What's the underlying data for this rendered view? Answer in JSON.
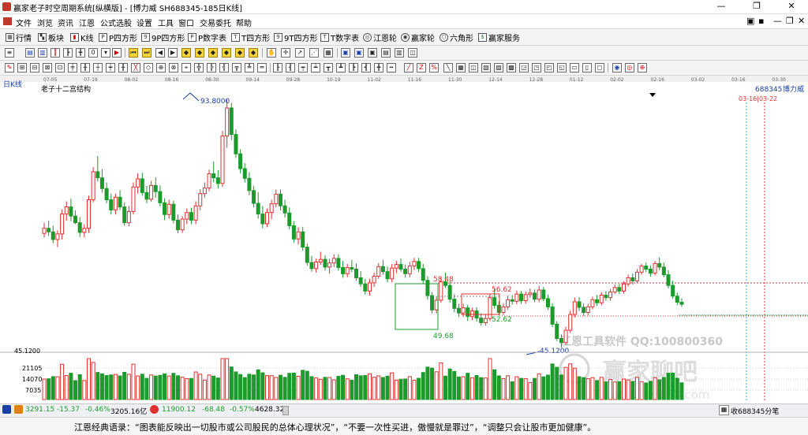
{
  "window": {
    "title": "赢家老子时空周期系统[纵横版] - [博力威  SH688345-185日K线]",
    "minimize": "—",
    "maximize": "❐",
    "close": "✕"
  },
  "menu": {
    "items": [
      "文件",
      "浏览",
      "资讯",
      "江恩",
      "公式选股",
      "设置",
      "工具",
      "窗口",
      "交易委托",
      "帮助"
    ],
    "right_icons": [
      "▣",
      "▪",
      "—",
      "❐",
      "✕"
    ]
  },
  "toolbar1": {
    "items": [
      {
        "label": "行情",
        "icon": "grid"
      },
      {
        "label": "板块",
        "icon": "blocks"
      },
      {
        "label": "K线",
        "icon": "candles"
      },
      {
        "label": "P四方形",
        "icon": "P"
      },
      {
        "label": "9P四方形",
        "icon": "9P"
      },
      {
        "label": "P数字表",
        "icon": "P"
      },
      {
        "label": "T四方形",
        "icon": "T"
      },
      {
        "label": "9T四方形",
        "icon": "9T"
      },
      {
        "label": "T数字表",
        "icon": "TN"
      },
      {
        "label": "江恩轮",
        "icon": "wheel"
      },
      {
        "label": "赢家轮",
        "icon": "wheel"
      },
      {
        "label": "六角形",
        "icon": "hex"
      },
      {
        "label": "赢家服务",
        "icon": "dollar"
      }
    ]
  },
  "chart": {
    "period_label": "日K线",
    "indicator_title": "老子十二宫结构",
    "x_dates": [
      "07-05",
      "07-19",
      "08-02",
      "08-16",
      "08-30",
      "09-14",
      "09-28",
      "10-19",
      "11-02",
      "11-16",
      "11-30",
      "12-14",
      "12-28",
      "01-12",
      "02-02",
      "02-16",
      "03-02",
      "03-16",
      "03-30"
    ],
    "stock_code": "688345",
    "stock_name": "博力威",
    "future_marker": "03-16|03-22",
    "price_labels": {
      "high": "93.8000",
      "low": "45.1200",
      "box1_top": "58.48",
      "box1_bottom": "49.68",
      "box2_top": "56.62",
      "box2_bottom": "52.62"
    },
    "volume_axis": [
      "45.1200",
      "21105",
      "14070",
      "7035"
    ],
    "watermark": {
      "software": "江恩工具软件  QQ:100800360",
      "brand": "赢家聊吧",
      "url": "liaoba.yy138.com"
    },
    "colors": {
      "up": "#e03030",
      "down": "#1c9b2c",
      "axis": "#a0a0a0",
      "guide_red": "#e03030",
      "box_green": "#1c9b2c",
      "label_blue": "#1a3ea8"
    }
  },
  "chart_data": {
    "type": "candlestick",
    "title": "老子十二宫结构",
    "symbol": "SH688345",
    "name": "博力威",
    "period": "日K线",
    "x_ticks": [
      "07-05",
      "07-19",
      "08-02",
      "08-16",
      "08-30",
      "09-14",
      "09-28",
      "10-19",
      "11-02",
      "11-16",
      "11-30",
      "12-14",
      "12-28",
      "01-12",
      "02-02",
      "02-16",
      "03-02",
      "03-16",
      "03-30"
    ],
    "price_range": [
      40,
      100
    ],
    "annotations": {
      "high": 93.8,
      "low": 45.12,
      "levels": [
        58.48,
        49.68,
        56.62,
        52.62
      ]
    },
    "volume_ticks": [
      21105,
      14070,
      7035
    ],
    "candles": [
      [
        67.5,
        69.6,
        66.7,
        68.5
      ],
      [
        68.5,
        70,
        67,
        67.8
      ],
      [
        67.8,
        69,
        65.6,
        66.3
      ],
      [
        66.3,
        68.1,
        64.8,
        67.4
      ],
      [
        67.4,
        72.2,
        66.3,
        71.3
      ],
      [
        71.3,
        73.8,
        70,
        72.7
      ],
      [
        72.7,
        74.3,
        69.9,
        70.9
      ],
      [
        70.9,
        72,
        69.3,
        69.6
      ],
      [
        69.6,
        70.7,
        66.8,
        67.7
      ],
      [
        67.7,
        69.3,
        66.7,
        68.5
      ],
      [
        68.5,
        74.9,
        67.6,
        74.1
      ],
      [
        74.1,
        80.5,
        73.6,
        79.6
      ],
      [
        79.6,
        82.7,
        77.7,
        78.4
      ],
      [
        78.4,
        80.1,
        75.5,
        76.3
      ],
      [
        76.3,
        77.5,
        73.4,
        74.1
      ],
      [
        74.1,
        75.3,
        71.2,
        72.1
      ],
      [
        72.1,
        75.3,
        71.2,
        74.6
      ],
      [
        74.6,
        76,
        72.1,
        72.7
      ],
      [
        72.7,
        73.6,
        69,
        69.6
      ],
      [
        69.6,
        72.9,
        68.9,
        71.8
      ],
      [
        71.8,
        77.5,
        71.2,
        76.6
      ],
      [
        76.6,
        79.3,
        75.3,
        78.2
      ],
      [
        78.2,
        79.4,
        74.9,
        75.5
      ],
      [
        75.5,
        76.8,
        73.4,
        74.2
      ],
      [
        74.2,
        77.8,
        73.7,
        76.9
      ],
      [
        76.9,
        78.5,
        74.5,
        75.7
      ],
      [
        75.7,
        76.9,
        72.8,
        73.5
      ],
      [
        73.5,
        74.4,
        70.1,
        71.2
      ],
      [
        71.2,
        74.1,
        70.4,
        73.2
      ],
      [
        73.2,
        73.9,
        69.5,
        70.1
      ],
      [
        70.1,
        71.2,
        67.5,
        68.2
      ],
      [
        68.2,
        70.9,
        67.6,
        70.3
      ],
      [
        70.3,
        72.4,
        69.3,
        71.6
      ],
      [
        71.6,
        72.5,
        69.3,
        70.1
      ],
      [
        70.1,
        73.8,
        69.3,
        72.9
      ],
      [
        72.9,
        76.2,
        72,
        75.3
      ],
      [
        75.3,
        77.5,
        74.5,
        76.4
      ],
      [
        76.4,
        80,
        75.8,
        79.2
      ],
      [
        79.2,
        81.6,
        77.5,
        78.4
      ],
      [
        78.4,
        79.9,
        76.3,
        77.3
      ],
      [
        77.3,
        87.6,
        76.6,
        86.6
      ],
      [
        86.6,
        93.8,
        84.3,
        92.1
      ],
      [
        92.1,
        93.1,
        85.8,
        86.9
      ],
      [
        86.9,
        87.9,
        82.3,
        83.1
      ],
      [
        83.1,
        84,
        79.3,
        80.2
      ],
      [
        80.2,
        81.3,
        77.5,
        78.3
      ],
      [
        78.3,
        79.5,
        75,
        75.9
      ],
      [
        75.9,
        76.8,
        72.6,
        73.4
      ],
      [
        73.4,
        75.6,
        70.4,
        71.3
      ],
      [
        71.3,
        72.9,
        68.5,
        69.4
      ],
      [
        69.4,
        72.4,
        68.7,
        71.6
      ],
      [
        71.6,
        74.1,
        70.3,
        73.3
      ],
      [
        73.3,
        76.1,
        72.6,
        75.2
      ],
      [
        75.2,
        76.1,
        72,
        72.9
      ],
      [
        72.9,
        74.1,
        70.6,
        71.5
      ],
      [
        71.5,
        72.6,
        68.3,
        69
      ],
      [
        69,
        69.9,
        65.7,
        66.4
      ],
      [
        66.4,
        68.7,
        65.3,
        67.8
      ],
      [
        67.8,
        68.8,
        64.1,
        64.8
      ],
      [
        64.8,
        65.5,
        61.2,
        61.8
      ],
      [
        61.8,
        63.1,
        60,
        60.6
      ],
      [
        60.6,
        62.6,
        59.8,
        61.9
      ],
      [
        61.9,
        63.9,
        61.3,
        62.4
      ],
      [
        62.4,
        63.2,
        60.2,
        60.9
      ],
      [
        60.9,
        62.5,
        59.6,
        61.7
      ],
      [
        61.7,
        63.4,
        60.9,
        62.6
      ],
      [
        62.6,
        63.4,
        60.2,
        60.8
      ],
      [
        60.8,
        62.1,
        58.8,
        59.6
      ],
      [
        59.6,
        61.5,
        58.9,
        60.8
      ],
      [
        60.8,
        62.3,
        59.9,
        60.5
      ],
      [
        60.5,
        61.6,
        58.2,
        58.8
      ],
      [
        58.8,
        60.1,
        57,
        57.6
      ],
      [
        57.6,
        58.6,
        55.5,
        56.2
      ],
      [
        56.2,
        58.6,
        55.3,
        57.8
      ],
      [
        57.8,
        59.8,
        57,
        59.1
      ],
      [
        59.1,
        61.7,
        58.6,
        61
      ],
      [
        61,
        62.3,
        59.4,
        60
      ],
      [
        60,
        61,
        57.9,
        58.6
      ],
      [
        58.6,
        61.5,
        57.9,
        60.7
      ],
      [
        60.7,
        62.1,
        59.7,
        61.4
      ],
      [
        61.4,
        62.6,
        60,
        60.5
      ],
      [
        60.5,
        61.4,
        58.8,
        59.6
      ],
      [
        59.6,
        61.9,
        58.9,
        61.1
      ],
      [
        61.1,
        62.7,
        60.3,
        62
      ],
      [
        62,
        62.7,
        59.9,
        60.6
      ],
      [
        60.6,
        61.5,
        57.7,
        58.3
      ],
      [
        58.3,
        59.1,
        54.5,
        55.3
      ],
      [
        55.3,
        56,
        51.8,
        52.5
      ],
      [
        52.5,
        55.2,
        51.8,
        54.4
      ],
      [
        54.4,
        58.9,
        53.9,
        58
      ],
      [
        58,
        59.8,
        56.8,
        57.3
      ],
      [
        57.3,
        58.1,
        53.9,
        54.6
      ],
      [
        54.6,
        55.6,
        52,
        52.8
      ],
      [
        52.8,
        53.7,
        51.1,
        51.9
      ],
      [
        51.9,
        53.7,
        51.1,
        52.9
      ],
      [
        52.9,
        53.5,
        50.3,
        51.2
      ],
      [
        51.2,
        52.9,
        50.5,
        52.3
      ],
      [
        52.3,
        53,
        50.2,
        50.9
      ],
      [
        50.9,
        51.8,
        49.4,
        50
      ],
      [
        50,
        51.7,
        49.4,
        50.8
      ],
      [
        50.8,
        55.7,
        50.3,
        54.9
      ],
      [
        54.9,
        56.7,
        52.8,
        53.4
      ],
      [
        53.4,
        54.2,
        51.4,
        52
      ],
      [
        52,
        53.8,
        51.5,
        53.1
      ],
      [
        53.1,
        55.3,
        52.5,
        54.5
      ],
      [
        54.5,
        55.4,
        53.5,
        54.2
      ],
      [
        54.2,
        56.3,
        53.6,
        55.6
      ],
      [
        55.6,
        56.2,
        53.7,
        54.3
      ],
      [
        54.3,
        56.1,
        53.7,
        55.5
      ],
      [
        55.5,
        56.7,
        54.9,
        55.8
      ],
      [
        55.8,
        56.5,
        54,
        54.6
      ],
      [
        54.6,
        57.2,
        54,
        56.4
      ],
      [
        56.4,
        57,
        54.2,
        54.7
      ],
      [
        54.7,
        55.5,
        52.5,
        53.1
      ],
      [
        53.1,
        53.8,
        49.1,
        49.7
      ],
      [
        49.7,
        50.3,
        46.4,
        46.9
      ],
      [
        46.9,
        47.7,
        45.12,
        46.1
      ],
      [
        46.1,
        49.2,
        45.6,
        48.5
      ],
      [
        48.5,
        52.3,
        48,
        51.6
      ],
      [
        51.6,
        54.9,
        51,
        54.1
      ],
      [
        54.1,
        55,
        52.3,
        53
      ],
      [
        53,
        53.8,
        51.3,
        52
      ],
      [
        52,
        53.7,
        51.4,
        53.1
      ],
      [
        53.1,
        55.1,
        52.6,
        54.5
      ],
      [
        54.5,
        55.4,
        53.3,
        53.9
      ],
      [
        53.9,
        56,
        53.4,
        55.4
      ],
      [
        55.4,
        56.2,
        54.3,
        54.9
      ],
      [
        54.9,
        56.6,
        54.3,
        56
      ],
      [
        56,
        57.5,
        55.6,
        56.9
      ],
      [
        56.9,
        57.6,
        55.6,
        56.2
      ],
      [
        56.2,
        58.1,
        55.7,
        57.6
      ],
      [
        57.6,
        59.4,
        57.1,
        58.8
      ],
      [
        58.8,
        59.6,
        57.5,
        58.2
      ],
      [
        58.2,
        60.5,
        57.7,
        59.9
      ],
      [
        59.9,
        61.5,
        59.4,
        61.1
      ],
      [
        61.1,
        61.8,
        59.9,
        60.5
      ],
      [
        60.5,
        61.2,
        59,
        59.7
      ],
      [
        59.7,
        62.1,
        59.3,
        61.6
      ],
      [
        61.6,
        62.8,
        60.3,
        60.9
      ],
      [
        60.9,
        61.8,
        58.9,
        59.4
      ],
      [
        59.4,
        60.3,
        56.7,
        57.3
      ],
      [
        57.3,
        58.2,
        54.7,
        55.2
      ],
      [
        55.2,
        55.9,
        53.4,
        54
      ],
      [
        54,
        54.8,
        53.1,
        53.6
      ]
    ],
    "future_dates": [
      "03-16",
      "03-22"
    ]
  },
  "status": {
    "sh_index": "3291.15",
    "sh_change": "-15.37",
    "sh_pct": "-0.46%",
    "sh_amount": "3205.16亿",
    "sz_index": "11900.12",
    "sz_change": "-68.48",
    "sz_pct": "-0.57%",
    "sz_amount": "4628.32",
    "right_text": "收688345分笔"
  },
  "quote": {
    "text": "江恩经典语录：“图表能反映出一切股市或公司股民的总体心理状况”，“不要一次性买进，傲慢就是罪过”，“调整只会让股市更加健康”。"
  }
}
